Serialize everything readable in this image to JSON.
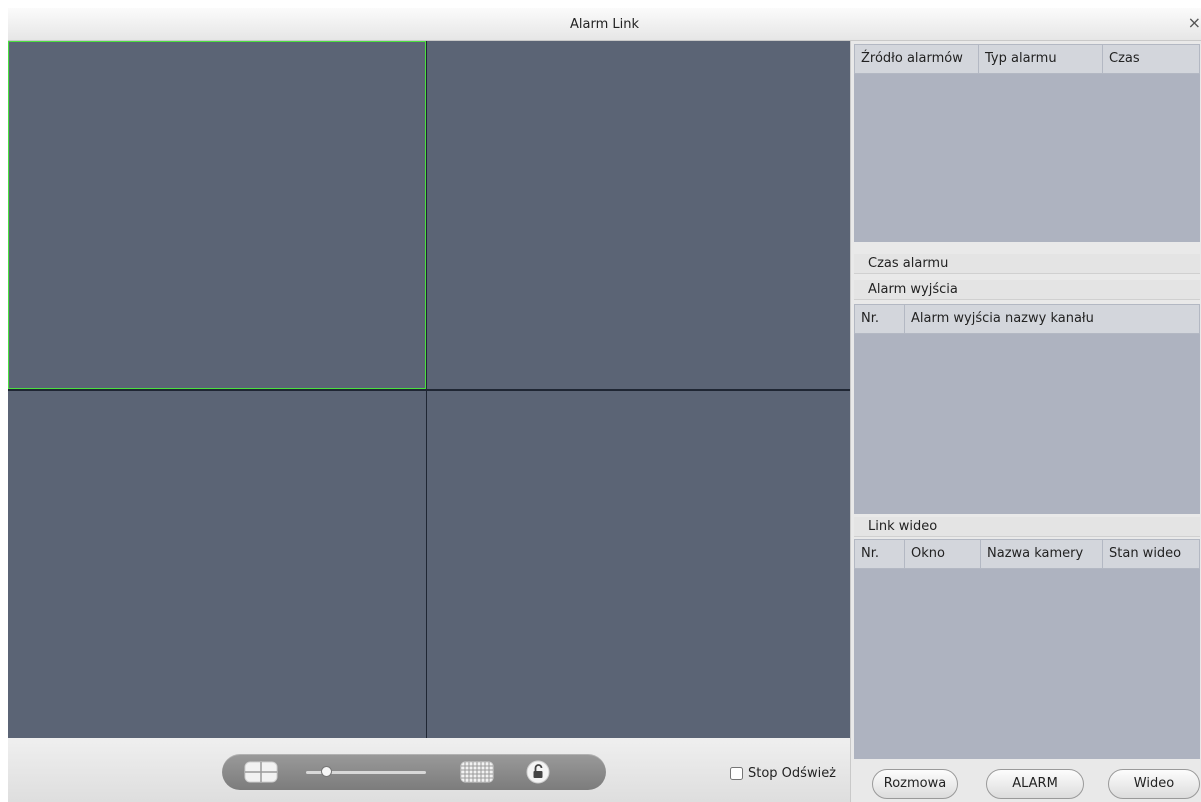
{
  "window": {
    "title": "Alarm Link",
    "close_glyph": "×"
  },
  "toolbar": {
    "layout_single_icon": "window-split-icon",
    "layout_grid_icon": "grid-layout-icon",
    "lock_icon": "lock-icon",
    "slider_level": 0.17,
    "stop_refresh_label": "Stop Odśwież",
    "stop_refresh_checked": false
  },
  "alarm_table": {
    "columns": [
      "Źródło alarmów",
      "Typ alarmu",
      "Czas"
    ]
  },
  "alarm_time": {
    "label": "Czas alarmu"
  },
  "alarm_output": {
    "label": "Alarm wyjścia",
    "columns": [
      "Nr.",
      "Alarm wyjścia nazwy kanału"
    ]
  },
  "video_link": {
    "label": "Link wideo",
    "columns": [
      "Nr.",
      "Okno",
      "Nazwa kamery",
      "Stan wideo"
    ]
  },
  "buttons": {
    "talk": "Rozmowa",
    "alarm": "ALARM",
    "video": "Wideo"
  },
  "colors": {
    "pane": "#5b6475",
    "active_border": "#4be03f",
    "table_body": "#aeb3c0"
  }
}
